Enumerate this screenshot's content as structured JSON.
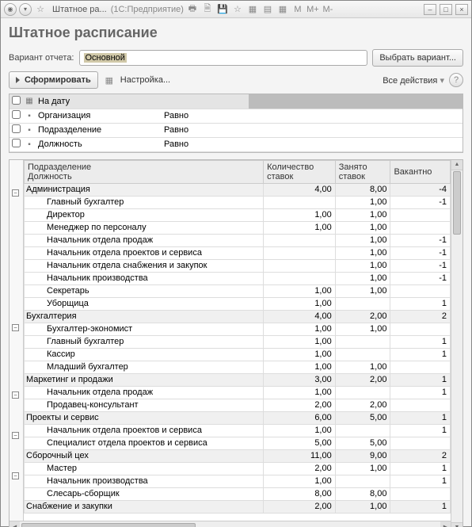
{
  "titlebar": {
    "title": "Штатное ра...",
    "subtitle": "(1С:Предприятие)",
    "m_labels": [
      "M",
      "M+",
      "M-"
    ]
  },
  "header": {
    "title": "Штатное расписание"
  },
  "variant": {
    "label": "Вариант отчета:",
    "value": "Основной",
    "choose": "Выбрать вариант..."
  },
  "toolbar": {
    "generate": "Сформировать",
    "settings": "Настройка...",
    "all_actions": "Все действия"
  },
  "filters": {
    "rows": [
      {
        "label": "На дату",
        "op": ""
      },
      {
        "label": "Организация",
        "op": "Равно"
      },
      {
        "label": "Подразделение",
        "op": "Равно"
      },
      {
        "label": "Должность",
        "op": "Равно"
      }
    ]
  },
  "report": {
    "columns": {
      "c1a": "Подразделение",
      "c1b": "Должность",
      "c2": "Количество ставок",
      "c3": "Занято ставок",
      "c4": "Вакантно"
    },
    "groups": [
      {
        "name": "Администрация",
        "qty": "4,00",
        "busy": "8,00",
        "vac": "-4",
        "rows": [
          {
            "name": "Главный бухгалтер",
            "qty": "",
            "busy": "1,00",
            "vac": "-1"
          },
          {
            "name": "Директор",
            "qty": "1,00",
            "busy": "1,00",
            "vac": ""
          },
          {
            "name": "Менеджер по персоналу",
            "qty": "1,00",
            "busy": "1,00",
            "vac": ""
          },
          {
            "name": "Начальник отдела продаж",
            "qty": "",
            "busy": "1,00",
            "vac": "-1"
          },
          {
            "name": "Начальник отдела проектов и сервиса",
            "qty": "",
            "busy": "1,00",
            "vac": "-1"
          },
          {
            "name": "Начальник отдела снабжения и закупок",
            "qty": "",
            "busy": "1,00",
            "vac": "-1"
          },
          {
            "name": "Начальник производства",
            "qty": "",
            "busy": "1,00",
            "vac": "-1"
          },
          {
            "name": "Секретарь",
            "qty": "1,00",
            "busy": "1,00",
            "vac": ""
          },
          {
            "name": "Уборщица",
            "qty": "1,00",
            "busy": "",
            "vac": "1"
          }
        ]
      },
      {
        "name": "Бухгалтерия",
        "qty": "4,00",
        "busy": "2,00",
        "vac": "2",
        "rows": [
          {
            "name": "Бухгалтер-экономист",
            "qty": "1,00",
            "busy": "1,00",
            "vac": ""
          },
          {
            "name": "Главный бухгалтер",
            "qty": "1,00",
            "busy": "",
            "vac": "1"
          },
          {
            "name": "Кассир",
            "qty": "1,00",
            "busy": "",
            "vac": "1"
          },
          {
            "name": "Младший бухгалтер",
            "qty": "1,00",
            "busy": "1,00",
            "vac": ""
          }
        ]
      },
      {
        "name": "Маркетинг и продажи",
        "qty": "3,00",
        "busy": "2,00",
        "vac": "1",
        "rows": [
          {
            "name": "Начальник отдела продаж",
            "qty": "1,00",
            "busy": "",
            "vac": "1"
          },
          {
            "name": "Продавец-консультант",
            "qty": "2,00",
            "busy": "2,00",
            "vac": ""
          }
        ]
      },
      {
        "name": "Проекты и сервис",
        "qty": "6,00",
        "busy": "5,00",
        "vac": "1",
        "rows": [
          {
            "name": "Начальник отдела проектов и сервиса",
            "qty": "1,00",
            "busy": "",
            "vac": "1"
          },
          {
            "name": "Специалист отдела проектов и сервиса",
            "qty": "5,00",
            "busy": "5,00",
            "vac": ""
          }
        ]
      },
      {
        "name": "Сборочный цех",
        "qty": "11,00",
        "busy": "9,00",
        "vac": "2",
        "rows": [
          {
            "name": "Мастер",
            "qty": "2,00",
            "busy": "1,00",
            "vac": "1"
          },
          {
            "name": "Начальник производства",
            "qty": "1,00",
            "busy": "",
            "vac": "1"
          },
          {
            "name": "Слесарь-сборщик",
            "qty": "8,00",
            "busy": "8,00",
            "vac": ""
          }
        ]
      },
      {
        "name": "Снабжение и закупки",
        "qty": "2,00",
        "busy": "1,00",
        "vac": "1",
        "rows": []
      }
    ]
  }
}
